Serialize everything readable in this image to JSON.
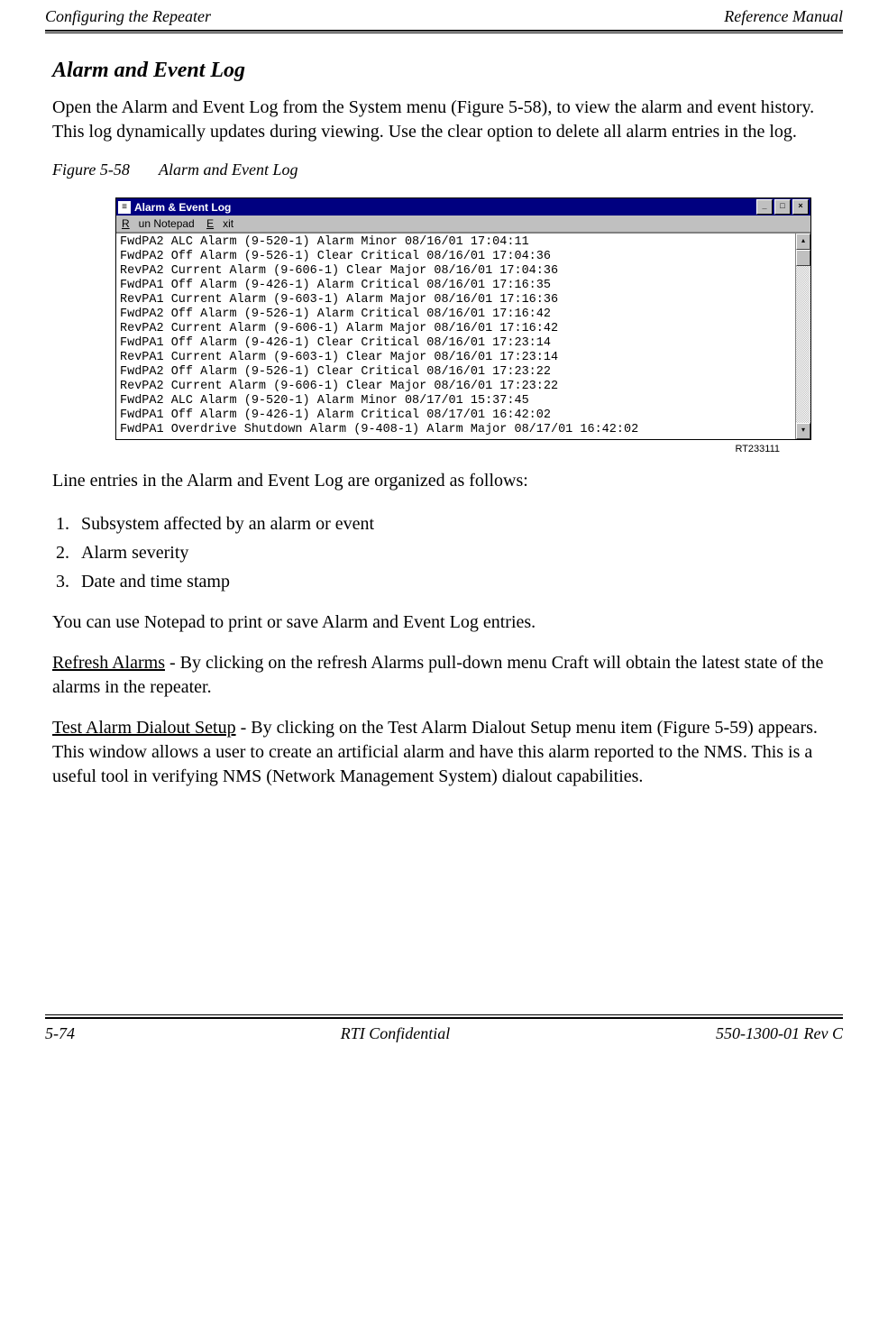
{
  "header": {
    "left": "Configuring the Repeater",
    "right": "Reference Manual"
  },
  "section_title": "Alarm and Event Log",
  "intro": "Open the Alarm and Event Log from the System menu (Figure 5-58), to view the alarm and event history. This log dynamically updates during viewing. Use the clear option to delete all alarm entries in the log.",
  "figure": {
    "number": "Figure 5-58",
    "title": "Alarm and Event Log"
  },
  "window": {
    "title": "Alarm & Event Log",
    "menu": {
      "run_notepad": "Run Notepad",
      "exit": "Exit"
    },
    "log_lines": "FwdPA2 ALC Alarm (9-520-1) Alarm Minor 08/16/01 17:04:11\nFwdPA2 Off Alarm (9-526-1) Clear Critical 08/16/01 17:04:36\nRevPA2 Current Alarm (9-606-1) Clear Major 08/16/01 17:04:36\nFwdPA1 Off Alarm (9-426-1) Alarm Critical 08/16/01 17:16:35\nRevPA1 Current Alarm (9-603-1) Alarm Major 08/16/01 17:16:36\nFwdPA2 Off Alarm (9-526-1) Alarm Critical 08/16/01 17:16:42\nRevPA2 Current Alarm (9-606-1) Alarm Major 08/16/01 17:16:42\nFwdPA1 Off Alarm (9-426-1) Clear Critical 08/16/01 17:23:14\nRevPA1 Current Alarm (9-603-1) Clear Major 08/16/01 17:23:14\nFwdPA2 Off Alarm (9-526-1) Clear Critical 08/16/01 17:23:22\nRevPA2 Current Alarm (9-606-1) Clear Major 08/16/01 17:23:22\nFwdPA2 ALC Alarm (9-520-1) Alarm Minor 08/17/01 15:37:45\nFwdPA1 Off Alarm (9-426-1) Alarm Critical 08/17/01 16:42:02\nFwdPA1 Overdrive Shutdown Alarm (9-408-1) Alarm Major 08/17/01 16:42:02"
  },
  "rt_label": "RT233111",
  "after_fig": "Line entries in the Alarm and Event Log are organized as follows:",
  "list": {
    "i1": "Subsystem affected by an alarm or event",
    "i2": "Alarm severity",
    "i3": "Date and time stamp"
  },
  "notepad_line": "You can use Notepad to print or save Alarm and Event Log entries.",
  "refresh": {
    "label": "Refresh Alarms",
    "text": " - By clicking on the refresh Alarms pull-down menu Craft will obtain the latest state of the alarms in the repeater."
  },
  "test": {
    "label": "Test Alarm Dialout Setup",
    "text": " - By clicking on the Test Alarm Dialout Setup menu item (Figure 5-59) appears. This window allows a user to create an artificial alarm and have this alarm reported to the NMS. This is a useful tool in verifying NMS (Network Management System) dialout capabilities."
  },
  "footer": {
    "left": "5-74",
    "center": "RTI Confidential",
    "right": "550-1300-01 Rev C"
  }
}
